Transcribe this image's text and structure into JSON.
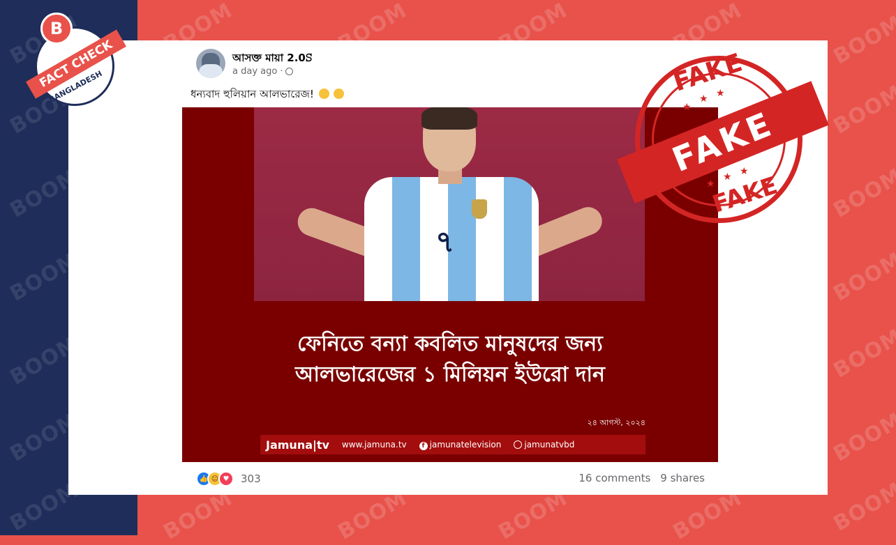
{
  "watermark": {
    "text": "BOOM"
  },
  "badge": {
    "logo_letter": "B",
    "ribbon": "FACT CHECK",
    "country": "BANGLADESH"
  },
  "stamp": {
    "top": "FAKE",
    "middle": "FAKE",
    "bottom": "FAKE"
  },
  "post": {
    "author": "আসক্ত মায়া 2.0ꕶ",
    "time": "a day ago",
    "privacy_icon": "globe-icon",
    "caption": "ধন্যবাদ হুলিয়ান আলভারেজ!",
    "image": {
      "headline_line1": "ফেনিতে বন্যা কবলিত মানুষদের জন্য",
      "headline_line2": "আলভারেজের ১ মিলিয়ন ইউরো দান",
      "date": "২৪ আগস্ট, ২০২৪",
      "jersey_number": "৭",
      "brand": "Jamuna|tv",
      "site": "www.jamuna.tv",
      "facebook": "jamunatelevision",
      "youtube": "jamunatvbd"
    },
    "reactions": {
      "count": "303",
      "types": [
        "like",
        "haha",
        "love"
      ]
    },
    "comments": "16 comments",
    "shares": "9 shares"
  },
  "colors": {
    "navy": "#1f2d5a",
    "red_bg": "#e8524a",
    "stamp_red": "#d42525",
    "facebook_blue": "#1877f2"
  }
}
